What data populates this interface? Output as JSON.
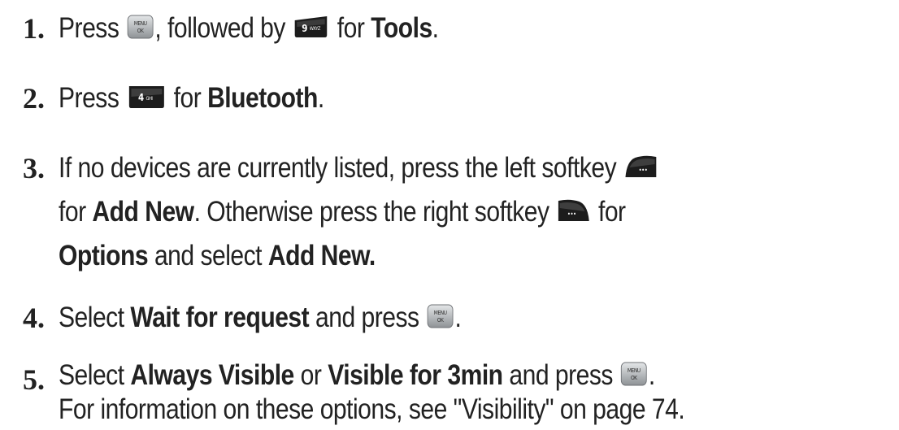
{
  "steps": [
    {
      "number": "1.",
      "parts": {
        "t1": "Press ",
        "key1": "menu-ok-key",
        "t2": ", followed by ",
        "key2": "9-wxyz-key",
        "t3": " for ",
        "b1": "Tools",
        "t4": "."
      }
    },
    {
      "number": "2.",
      "parts": {
        "t1": "Press ",
        "key1": "4-ghi-key",
        "t2": " for ",
        "b1": "Bluetooth",
        "t3": "."
      }
    },
    {
      "number": "3.",
      "lines": [
        {
          "t1": "If no devices are currently listed, press the left softkey ",
          "key1": "left-softkey"
        },
        {
          "t1": "for ",
          "b1": "Add New",
          "t2": ". Otherwise press the right softkey ",
          "key1": "right-softkey",
          "t3": " for"
        },
        {
          "b1": "Options",
          "t1": " and select ",
          "b2": "Add New."
        }
      ]
    },
    {
      "number": "4.",
      "parts": {
        "t1": "Select ",
        "b1": "Wait for request",
        "t2": " and press ",
        "key1": "menu-ok-key",
        "t3": "."
      }
    },
    {
      "number": "5.",
      "lines": [
        {
          "t1": "Select ",
          "b1": "Always Visible",
          "t2": " or ",
          "b2": "Visible for 3min",
          "t3": " and press ",
          "key1": "menu-ok-key",
          "t4": "."
        },
        {
          "t1": "For information on these options, see \"Visibility\" on page 74."
        }
      ]
    }
  ],
  "key_labels": {
    "menu_ok_top": "MENU",
    "menu_ok_bottom": "OK",
    "nine_num": "9",
    "nine_letters": "WXYZ",
    "four_num": "4",
    "four_letters": "GHI",
    "softkey_dots": "•••"
  },
  "colors": {
    "text": "#222222",
    "key_dark": "#1c1c1c",
    "key_silver": "#b9bcbf"
  }
}
